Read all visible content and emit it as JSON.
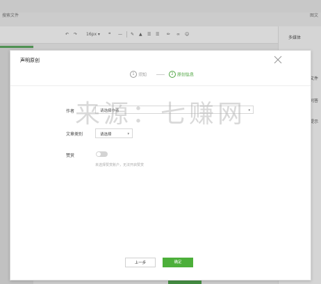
{
  "background": {
    "title_left": "搜索文件",
    "title_right": "图文",
    "toolbar": {
      "undo": "↶",
      "redo": "↷",
      "font_size": "16px ▾",
      "quote": "❝",
      "divider": "—"
    },
    "right_panel_title": "多媒体",
    "right_panel_items": [
      "文件",
      "问答",
      "提示"
    ]
  },
  "modal": {
    "title": "声明原创",
    "steps": [
      {
        "num": "1",
        "label": "须知"
      },
      {
        "num": "2",
        "label": "原创信息"
      }
    ],
    "author": {
      "label": "作者",
      "value": "请选择作者"
    },
    "category": {
      "label": "文章类别",
      "value": "请选择"
    },
    "reward": {
      "label": "赞赏",
      "hint": "未选择赞赏账户，无法开启赞赏",
      "enabled": false
    },
    "prev_label": "上一步",
    "confirm_label": "确定"
  },
  "watermark": "来源：七赚网",
  "colors": {
    "accent": "#4caf3a",
    "step_active": "#4ca33f"
  }
}
